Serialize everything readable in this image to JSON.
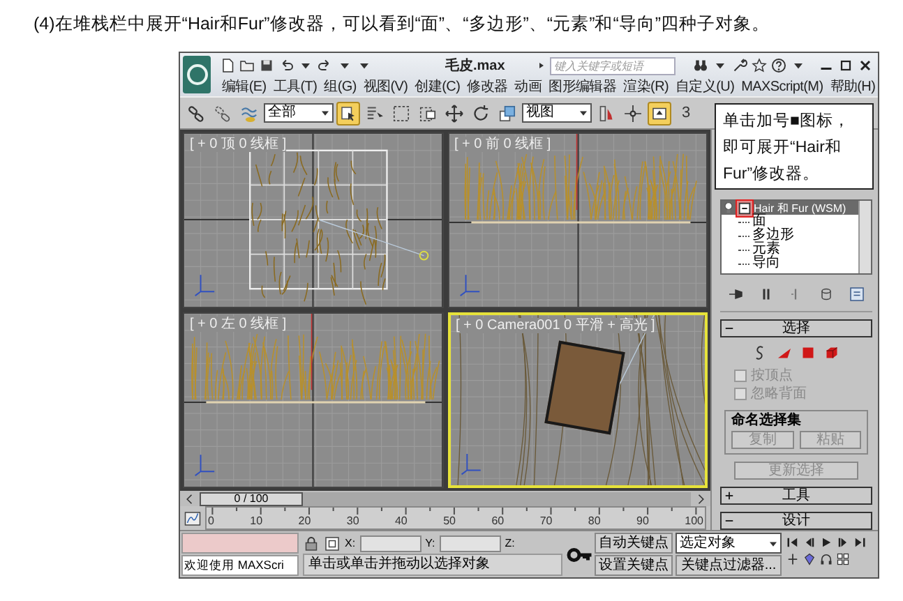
{
  "caption": "(4)在堆栈栏中展开“Hair和Fur”修改器，可以看到“面”、“多边形”、“元素”和“导向”四种子对象。",
  "window": {
    "title": "毛皮.max",
    "search": {
      "placeholder": "键入关键字或短语"
    }
  },
  "menu": [
    {
      "label": "编辑(E)"
    },
    {
      "label": "工具(T)"
    },
    {
      "label": "组(G)"
    },
    {
      "label": "视图(V)"
    },
    {
      "label": "创建(C)"
    },
    {
      "label": "修改器"
    },
    {
      "label": "动画"
    },
    {
      "label": "图形编辑器"
    },
    {
      "label": "渲染(R)"
    },
    {
      "label": "自定义(U)"
    },
    {
      "label": "MAXScript(M)"
    },
    {
      "label": "帮助(H)"
    }
  ],
  "toolbar": [
    {
      "kind": "link",
      "selected": false
    },
    {
      "kind": "unlink",
      "selected": false
    },
    {
      "kind": "bind",
      "selected": false
    },
    {
      "kind": "dropdown",
      "value": "全部"
    },
    {
      "kind": "select",
      "selected": true
    },
    {
      "kind": "select_name",
      "selected": false
    },
    {
      "kind": "rect_region",
      "selected": false
    },
    {
      "kind": "window",
      "selected": false
    },
    {
      "kind": "move",
      "selected": false
    },
    {
      "kind": "rotate",
      "selected": false
    },
    {
      "kind": "scale",
      "selected": false
    },
    {
      "kind": "dropdown",
      "value": "视图"
    },
    {
      "kind": "mirror",
      "selected": false
    },
    {
      "kind": "pivot",
      "selected": false
    },
    {
      "kind": "manipulate",
      "selected": true
    },
    {
      "kind": "snap",
      "label": "3",
      "selected": false
    }
  ],
  "viewports": [
    {
      "kind": "top",
      "label": "[ + 0 顶 0 线框 ]",
      "selected": false
    },
    {
      "kind": "front",
      "label": "[ + 0 前 0 线框 ]",
      "selected": false
    },
    {
      "kind": "left",
      "label": "[ + 0 左 0 线框 ]",
      "selected": false
    },
    {
      "kind": "camera",
      "label": "[ + 0 Camera001 0 平滑 + 高光 ]",
      "selected": true
    }
  ],
  "callout": "单击加号■图标，即可展开“Hair和Fur”修改器。",
  "modifier_stack": [
    {
      "label": "Hair 和 Fur (WSM)",
      "expanded": true,
      "selected": true,
      "children": [
        {
          "label": "面"
        },
        {
          "label": "多边形"
        },
        {
          "label": "元素"
        },
        {
          "label": "导向"
        }
      ]
    }
  ],
  "selection_rollout": {
    "title": "选择",
    "expanded": true,
    "checkboxes": [
      {
        "label": "按顶点",
        "checked": false,
        "disabled": true
      },
      {
        "label": "忽略背面",
        "checked": false,
        "disabled": true
      }
    ],
    "named_sets": {
      "title": "命名选择集",
      "buttons": [
        {
          "label": "复制",
          "disabled": true
        },
        {
          "label": "粘贴",
          "disabled": true
        }
      ]
    },
    "update_button": {
      "label": "更新选择",
      "disabled": true
    }
  },
  "rollouts": [
    {
      "title": "工具",
      "expanded": false
    },
    {
      "title": "设计",
      "expanded": true
    }
  ],
  "timeline": {
    "frame": "0 / 100",
    "level": 0,
    "ticks": [
      "0",
      "10",
      "20",
      "30",
      "40",
      "50",
      "60",
      "70",
      "80",
      "90",
      "100"
    ]
  },
  "status": {
    "maxscript": "欢迎使用 MAXScri",
    "prompt": "单击或单击并拖动以选择对象",
    "x_label": "X:",
    "y_label": "Y:",
    "z_label": "Z:",
    "auto_key": "自动关键点",
    "set_key": "设置关键点",
    "key_mode": "选定对象",
    "key_filters": "关键点过滤器..."
  }
}
